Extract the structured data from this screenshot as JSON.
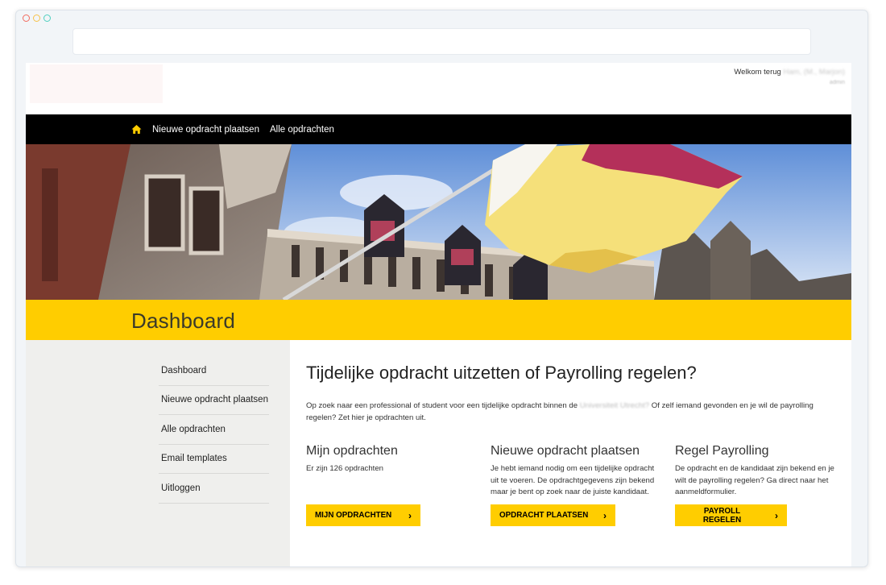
{
  "header": {
    "welcome_text": "Welkom terug",
    "user_name": "Ham, (M., Marjon)",
    "user_role": "admin"
  },
  "topnav": {
    "items": [
      {
        "label": "Nieuwe opdracht plaatsen"
      },
      {
        "label": "Alle opdrachten"
      }
    ]
  },
  "banner": {
    "title": "Dashboard"
  },
  "sidebar": {
    "items": [
      {
        "label": "Dashboard"
      },
      {
        "label": "Nieuwe opdracht plaatsen"
      },
      {
        "label": "Alle opdrachten"
      },
      {
        "label": "Email templates"
      },
      {
        "label": "Uitloggen"
      }
    ]
  },
  "main": {
    "heading": "Tijdelijke opdracht uitzetten of Payrolling regelen?",
    "intro_part1": "Op zoek naar een professional of student voor een tijdelijke opdracht binnen de",
    "intro_org": "Universiteit Utrecht?",
    "intro_part2": "Of zelf iemand gevonden en je wil de payrolling regelen? Zet hier je opdrachten uit.",
    "cards": [
      {
        "title": "Mijn opdrachten",
        "text": "Er zijn 126 opdrachten",
        "button": "MIJN OPDRACHTEN"
      },
      {
        "title": "Nieuwe opdracht plaatsen",
        "text": "Je hebt iemand nodig om een tijdelijke opdracht uit te voeren. De opdrachtgegevens zijn bekend maar je bent op zoek naar de juiste kandidaat.",
        "button": "OPDRACHT PLAATSEN"
      },
      {
        "title": "Regel Payrolling",
        "text": "De opdracht en de kandidaat zijn bekend en je wilt de payrolling regelen? Ga direct naar het aanmeldformulier.",
        "button": "PAYROLL REGELEN"
      }
    ]
  },
  "colors": {
    "accent": "#ffcd00",
    "nav_bg": "#000000",
    "sidebar_bg": "#efefed"
  }
}
